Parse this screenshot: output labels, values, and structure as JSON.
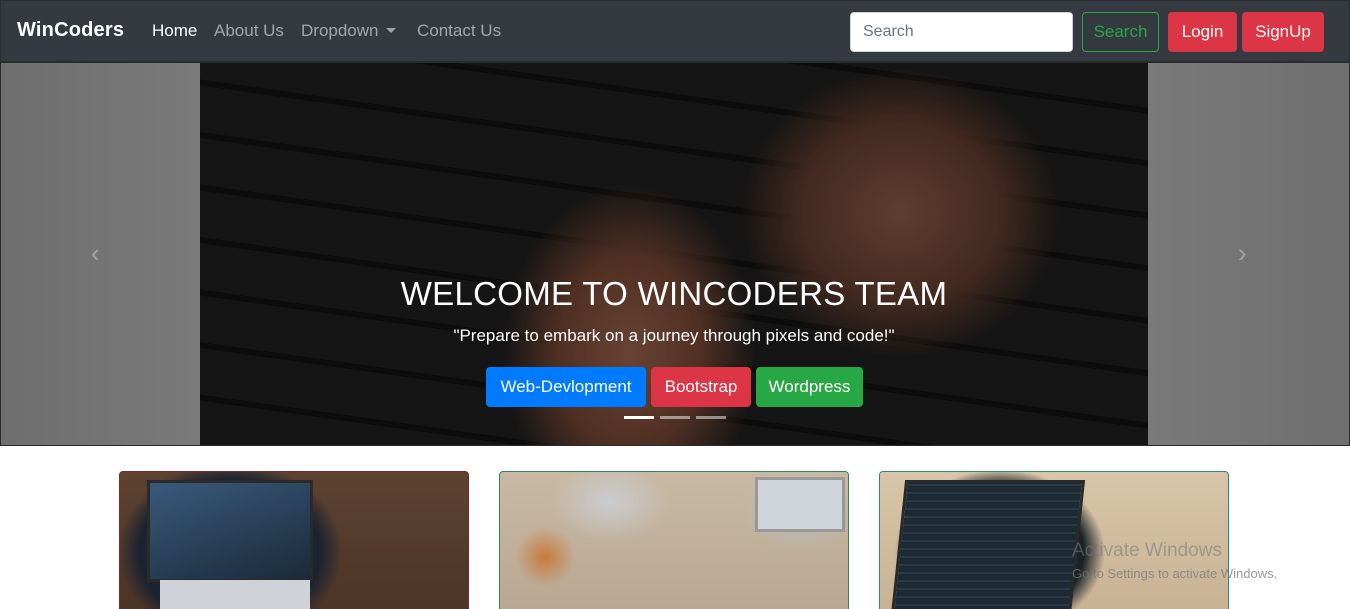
{
  "navbar": {
    "brand": "WinCoders",
    "links": [
      {
        "label": "Home"
      },
      {
        "label": "About Us"
      },
      {
        "label": "Dropdown"
      },
      {
        "label": "Contact Us"
      }
    ],
    "search_placeholder": "Search",
    "search_button": "Search",
    "login_button": "Login",
    "signup_button": "SignUp"
  },
  "carousel": {
    "title": "WELCOME TO WINCODERS TEAM",
    "subtitle": "\"Prepare to embark on a journey through pixels and code!\"",
    "buttons": [
      {
        "label": "Web-Devlopment",
        "color": "#007bff"
      },
      {
        "label": "Bootstrap",
        "color": "#dc3545"
      },
      {
        "label": "Wordpress",
        "color": "#28a745"
      }
    ],
    "active_slide": 1,
    "slide_count": 3,
    "prev_icon": "chevron-left-icon",
    "next_icon": "chevron-right-icon"
  },
  "watermark": {
    "title": "Activate Windows",
    "subtitle": "Go to Settings to activate Windows."
  },
  "colors": {
    "navbar_bg": "#343a40",
    "danger": "#dc3545",
    "success": "#28a745",
    "primary": "#007bff"
  }
}
